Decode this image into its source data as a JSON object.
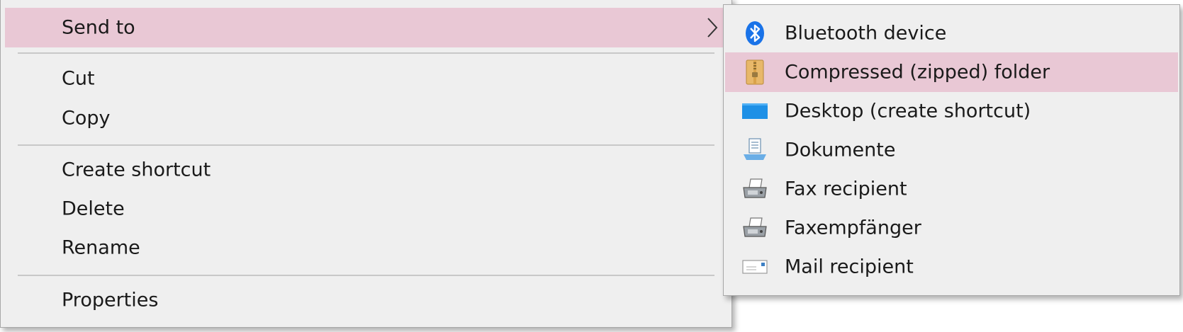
{
  "main_menu": {
    "items": [
      {
        "label": "Send to"
      },
      {
        "label": "Cut"
      },
      {
        "label": "Copy"
      },
      {
        "label": "Create shortcut"
      },
      {
        "label": "Delete"
      },
      {
        "label": "Rename"
      },
      {
        "label": "Properties"
      }
    ]
  },
  "send_to_menu": {
    "items": [
      {
        "label": "Bluetooth device",
        "icon": "bluetooth-icon"
      },
      {
        "label": "Compressed (zipped) folder",
        "icon": "zip-folder-icon"
      },
      {
        "label": "Desktop (create shortcut)",
        "icon": "desktop-icon"
      },
      {
        "label": "Dokumente",
        "icon": "documents-icon"
      },
      {
        "label": "Fax recipient",
        "icon": "fax-icon"
      },
      {
        "label": "Faxempfänger",
        "icon": "fax-icon"
      },
      {
        "label": "Mail recipient",
        "icon": "mail-icon"
      }
    ]
  },
  "colors": {
    "menu_background": "#efefef",
    "highlight": "#e9c8d5",
    "separator": "#c8c8c8",
    "bluetooth": "#1a73e8",
    "desktop": "#1e90e6"
  }
}
